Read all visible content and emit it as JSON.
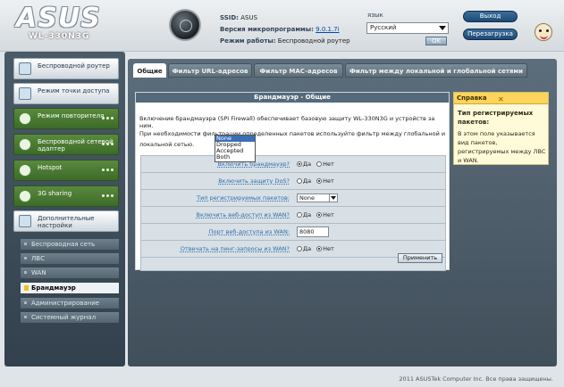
{
  "header": {
    "brand": "ASUS",
    "model": "WL-330N3G",
    "ssid_label": "SSID:",
    "ssid_value": "ASUS",
    "fw_label": "Версия микропрограммы:",
    "fw_value": "9.0.1.7i",
    "mode_label": "Режим работы:",
    "mode_value": "Беспроводной роутер",
    "lang_label": "язык",
    "lang_value": "Русский",
    "ok_label": "OK",
    "logout_label": "Выход",
    "reboot_label": "Перезагрузка"
  },
  "sidebar": {
    "big_items": [
      {
        "label": "Беспроводной роутер",
        "icon": "router-icon",
        "style": "plain"
      },
      {
        "label": "Режим точки доступа",
        "icon": "access-point-icon",
        "style": "plain"
      },
      {
        "label": "Режим повторителя",
        "icon": "repeater-icon",
        "style": "green"
      },
      {
        "label": "Беспроводной сетевой адаптер",
        "icon": "wireless-adapter-icon",
        "style": "green"
      },
      {
        "label": "Hotspot",
        "icon": "hotspot-icon",
        "style": "green"
      },
      {
        "label": "3G sharing",
        "icon": "3g-icon",
        "style": "green"
      },
      {
        "label": "Дополнительные настройки",
        "icon": "settings-icon",
        "style": "plain"
      }
    ],
    "sub_items": [
      {
        "label": "Беспроводная сеть"
      },
      {
        "label": "ЛВС"
      },
      {
        "label": "WAN"
      },
      {
        "label": "Брандмауэр",
        "active": true
      },
      {
        "label": "Администрирование"
      },
      {
        "label": "Системный журнал"
      }
    ]
  },
  "tabs": [
    "Общие",
    "Фильтр URL-адресов",
    "Фильтр MAC-адресов",
    "Фильтр между локальной и глобальной сетями"
  ],
  "content": {
    "title": "Брандмауэр - Общие",
    "desc1": "Включение брандмауэра (SPI Firewall) обеспечивает базовую защиту WL-330N3G и устройств за ним.",
    "desc2": "При необходимости фильтрации определенных пакетов используйте фильтр между глобальной и локальной сетью.",
    "rows": [
      {
        "label": "Включить брандмауэр?",
        "yes": "Да",
        "no": "Нет",
        "selected": "yes"
      },
      {
        "label": "Включить защиту DoS?",
        "yes": "Да",
        "no": "Нет",
        "selected": "no"
      },
      {
        "label": "Тип регистрируемых пакетов:",
        "select_value": "None"
      },
      {
        "label": "Включить веб-доступ из WAN?",
        "yes": "Да",
        "no": "Нет",
        "selected": "no"
      },
      {
        "label": "Порт веб-доступа из WAN:",
        "input_value": "8080"
      },
      {
        "label": "Отвечать на пинг-запросы из WAN?",
        "yes": "Да",
        "no": "Нет",
        "selected": "no"
      }
    ],
    "dropdown_options": [
      "None",
      "Dropped",
      "Accepted",
      "Both"
    ],
    "apply_label": "Применить"
  },
  "help": {
    "title": "Справка",
    "close": "✕",
    "topic": "Тип регистрируемых пакетов:",
    "body": "В этом поле указывается вид пакетов, регистрируемых между ЛВС и WAN."
  },
  "footer": "2011 ASUSTek Computer Inc. Все права защищены."
}
